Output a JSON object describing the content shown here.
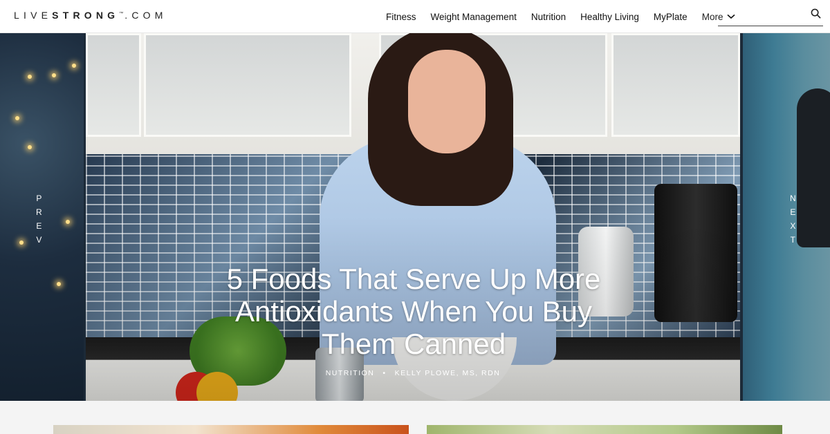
{
  "header": {
    "logo": {
      "prefix": "LIVE",
      "strong": "STRONG",
      "tm": "™",
      "suffix": ".COM"
    },
    "nav": [
      "Fitness",
      "Weight Management",
      "Nutrition",
      "Healthy Living",
      "MyPlate"
    ],
    "more_label": "More",
    "search": {
      "placeholder": "",
      "icon": "search-icon"
    }
  },
  "carousel": {
    "prev_label": [
      "P",
      "R",
      "E",
      "V"
    ],
    "next_label": [
      "N",
      "E",
      "X",
      "T"
    ],
    "slide": {
      "headline": "5 Foods That Serve Up More Antioxidants When You Buy Them Canned",
      "category": "Nutrition",
      "author": "Kelly Plowe, MS, RDN"
    }
  },
  "colors": {
    "header_bg": "#ffffff",
    "page_bg": "#f4f4f4",
    "headline_text": "#ffffff"
  }
}
